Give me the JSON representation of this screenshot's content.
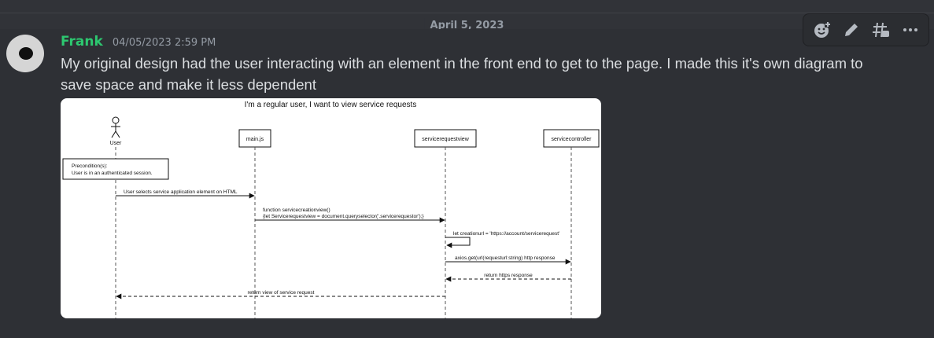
{
  "date_divider": "April 5, 2023",
  "message": {
    "username": "Frank",
    "timestamp": "04/05/2023 2:59 PM",
    "text": "My original design had the user interacting with an element in the front end to get to the page. I made this it's own diagram to save space and make it less dependent"
  },
  "toolbar": {
    "icons": [
      "add-reaction-icon",
      "edit-icon",
      "create-thread-icon",
      "more-icon"
    ]
  },
  "diagram": {
    "title": "I'm a regular user, I want to view service requests",
    "actor_label": "User",
    "participants": [
      "main.js",
      "servicerequestview",
      "servicecontroller"
    ],
    "precondition_line1": "Precondition(s):",
    "precondition_line2": "User is in an authenticated session.",
    "msg1": "User selects service application element on HTML",
    "msg2_line1": "function servicecreationview()",
    "msg2_line2": "{let Servicerequestview = document.queryselector('.servicerequestor');}",
    "msg3": "let creationurl = 'https://account/servicerequest'",
    "msg4": "axios.get(url(requesturl:string) http response",
    "msg5": "return https response",
    "msg6": "return view of service request"
  }
}
